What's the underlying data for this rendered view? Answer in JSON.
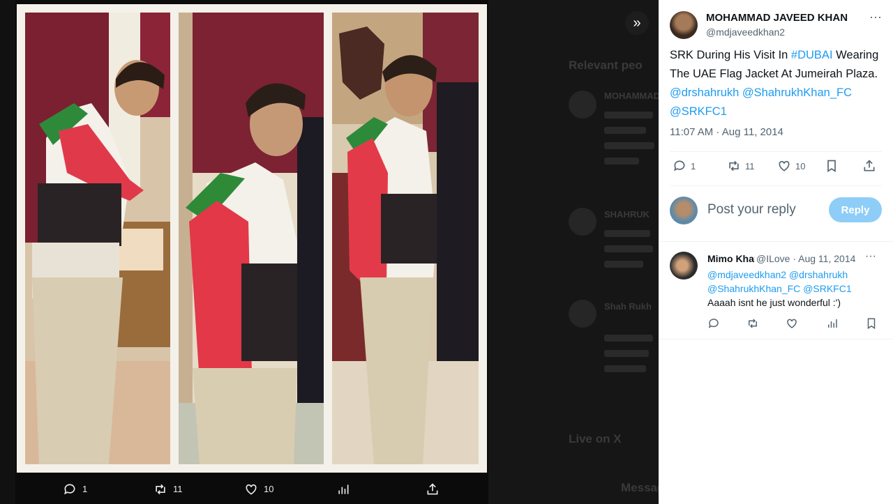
{
  "viewer": {
    "background_timeline": {
      "relevant_heading": "Relevant peo",
      "live_heading": "Live on X",
      "partial_texts": [
        "MOHAMMAD",
        "SHAHRUK",
        "Shah Rukh",
        "Message"
      ]
    },
    "collage_panels": [
      "panel-1",
      "panel-2",
      "panel-3"
    ],
    "expand_icon": "chevrons-right-icon",
    "actions": {
      "reply_count": "1",
      "retweet_count": "11",
      "like_count": "10",
      "views_count": "",
      "share_count": ""
    }
  },
  "tweet": {
    "author_name": "MOHAMMAD JAVEED KHAN",
    "author_handle": "@mdjaveedkhan2",
    "text_plain_1": "SRK During His Visit In ",
    "hashtag": "#DUBAI",
    "text_plain_2": " Wearing The UAE Flag Jacket At Jumeirah Plaza. ",
    "mention_1": "@drshahrukh",
    "mention_2": "@ShahrukhKhan_FC",
    "mention_3": "@SRKFC1",
    "timestamp": "11:07 AM · Aug 11, 2014",
    "actions": {
      "reply_count": "1",
      "retweet_count": "11",
      "like_count": "10"
    }
  },
  "reply_box": {
    "placeholder": "Post your reply",
    "button_label": "Reply"
  },
  "comment": {
    "name": "Mimo Khan",
    "meta": "@ILove · Aug 11, 2014",
    "mentions_1": "@mdjaveedkhan2",
    "mentions_2": "@drshahrukh",
    "mentions_3": "@ShahrukhKhan_FC",
    "mentions_4": "@SRKFC1",
    "text": "Aaaah isnt he just wonderful :')"
  },
  "colors": {
    "link": "#1d9bf0",
    "reply_button": "#8ecdf8",
    "muted_text": "#536471"
  }
}
